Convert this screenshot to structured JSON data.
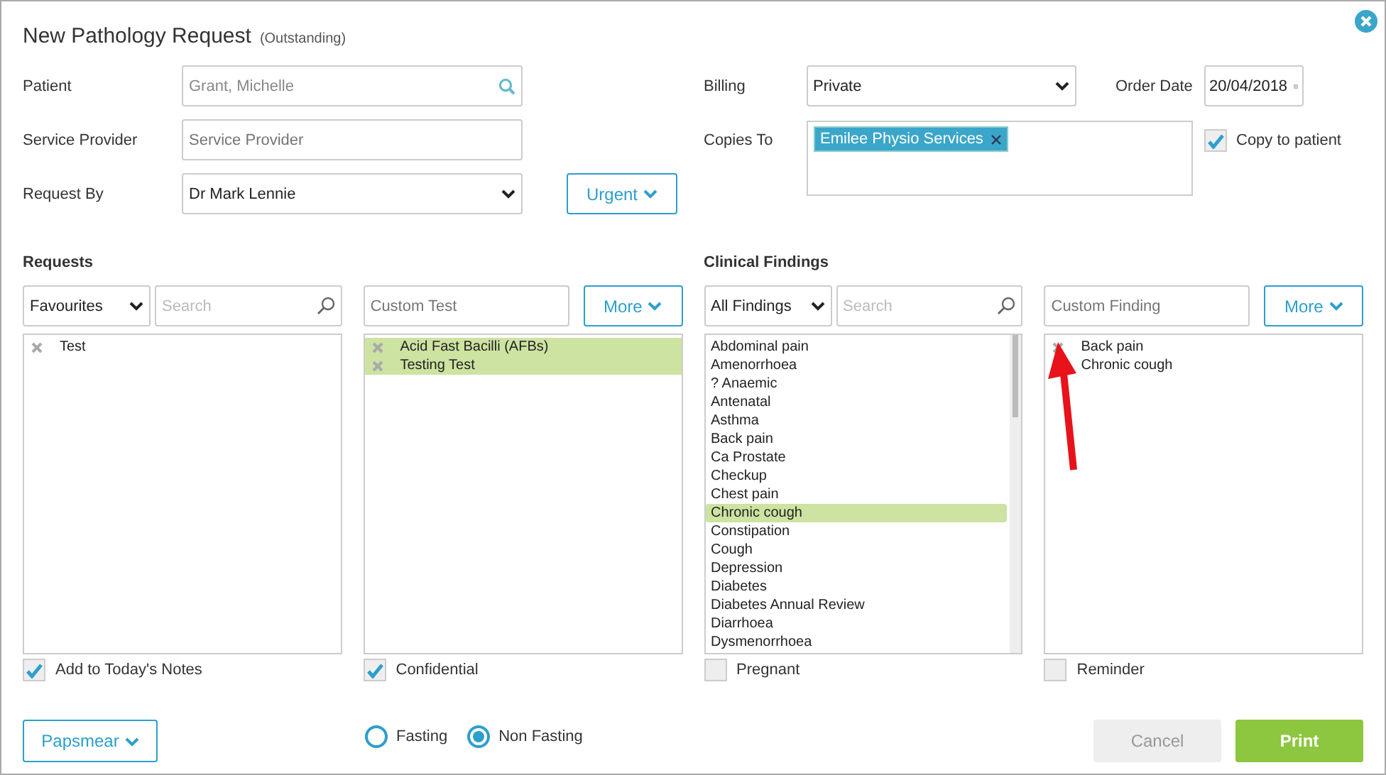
{
  "dialog": {
    "title": "New Pathology Request",
    "status": "(Outstanding)"
  },
  "form": {
    "patient": {
      "label": "Patient",
      "value": "Grant, Michelle"
    },
    "service_provider": {
      "label": "Service Provider",
      "placeholder": "Service Provider"
    },
    "request_by": {
      "label": "Request By",
      "value": "Dr Mark Lennie"
    },
    "urgency_button": "Urgent",
    "billing": {
      "label": "Billing",
      "value": "Private"
    },
    "order_date": {
      "label": "Order Date",
      "value": "20/04/2018"
    },
    "copies_to": {
      "label": "Copies To",
      "tags": [
        "Emilee Physio Services"
      ]
    },
    "copy_to_patient": {
      "label": "Copy to patient",
      "checked": true
    }
  },
  "requests": {
    "heading": "Requests",
    "filter": "Favourites",
    "search_placeholder": "Search",
    "favourites": [
      {
        "label": "Test",
        "selected": false
      }
    ],
    "custom_placeholder": "Custom Test",
    "more_button": "More",
    "selected_tests": [
      {
        "label": "Acid Fast Bacilli (AFBs)",
        "selected": true
      },
      {
        "label": "Testing Test",
        "selected": true
      }
    ],
    "options": [
      {
        "label": "Add to Today's Notes",
        "checked": true
      },
      {
        "label": "Confidential",
        "checked": true
      }
    ]
  },
  "clinical_findings": {
    "heading": "Clinical Findings",
    "filter": "All Findings",
    "search_placeholder": "Search",
    "findings": [
      {
        "label": "Abdominal pain",
        "selected": false
      },
      {
        "label": "Amenorrhoea",
        "selected": false
      },
      {
        "label": "? Anaemic",
        "selected": false
      },
      {
        "label": "Antenatal",
        "selected": false
      },
      {
        "label": "Asthma",
        "selected": false
      },
      {
        "label": "Back pain",
        "selected": false
      },
      {
        "label": "Ca Prostate",
        "selected": false
      },
      {
        "label": "Checkup",
        "selected": false
      },
      {
        "label": "Chest pain",
        "selected": false
      },
      {
        "label": "Chronic cough",
        "selected": true
      },
      {
        "label": "Constipation",
        "selected": false
      },
      {
        "label": "Cough",
        "selected": false
      },
      {
        "label": "Depression",
        "selected": false
      },
      {
        "label": "Diabetes",
        "selected": false
      },
      {
        "label": "Diabetes Annual Review",
        "selected": false
      },
      {
        "label": "Diarrhoea",
        "selected": false
      },
      {
        "label": "Dysmenorrhoea",
        "selected": false
      }
    ],
    "custom_placeholder": "Custom Finding",
    "more_button": "More",
    "selected_findings": [
      {
        "label": "Back pain",
        "selected": false
      },
      {
        "label": "Chronic cough",
        "selected": false
      }
    ],
    "options": [
      {
        "label": "Pregnant",
        "checked": false
      },
      {
        "label": "Reminder",
        "checked": false
      }
    ]
  },
  "footer": {
    "papsmear_button": "Papsmear",
    "fasting": [
      {
        "label": "Fasting",
        "selected": false
      },
      {
        "label": "Non Fasting",
        "selected": true
      }
    ],
    "cancel_button": "Cancel",
    "print_button": "Print"
  },
  "annotations": [
    {
      "kind": "arrow"
    }
  ]
}
